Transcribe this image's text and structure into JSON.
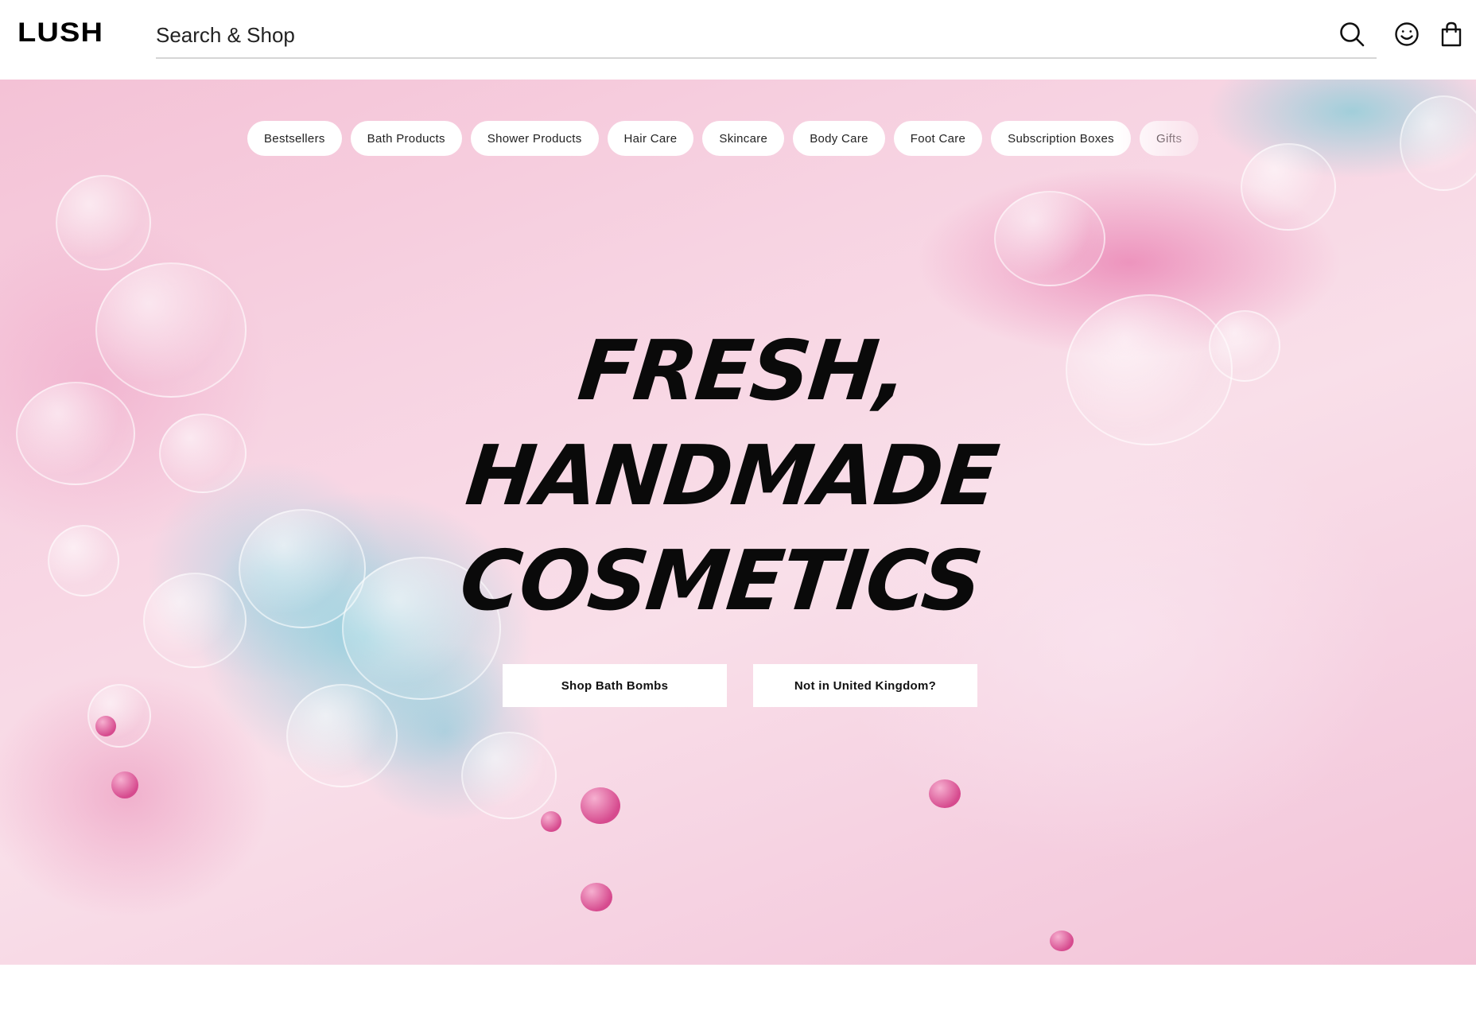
{
  "header": {
    "logo": "LUSH",
    "search": {
      "placeholder": "Search & Shop",
      "value": ""
    },
    "icons": [
      "search-icon",
      "account-icon",
      "bag-icon"
    ]
  },
  "categories": [
    {
      "label": "Bestsellers"
    },
    {
      "label": "Bath Products"
    },
    {
      "label": "Shower Products"
    },
    {
      "label": "Hair Care"
    },
    {
      "label": "Skincare"
    },
    {
      "label": "Body Care"
    },
    {
      "label": "Foot Care"
    },
    {
      "label": "Subscription Boxes"
    },
    {
      "label": "Gifts"
    }
  ],
  "hero": {
    "headline": [
      "FRESH,",
      "HANDMADE",
      "COSMETICS"
    ],
    "buttons": {
      "primary": "Shop Bath Bombs",
      "secondary": "Not in United Kingdom?"
    }
  },
  "colors": {
    "background_pink": "#f7d3e2",
    "accent_blue": "#50c8d7",
    "accent_magenta": "#d64a8e",
    "text": "#0a0a0a"
  }
}
